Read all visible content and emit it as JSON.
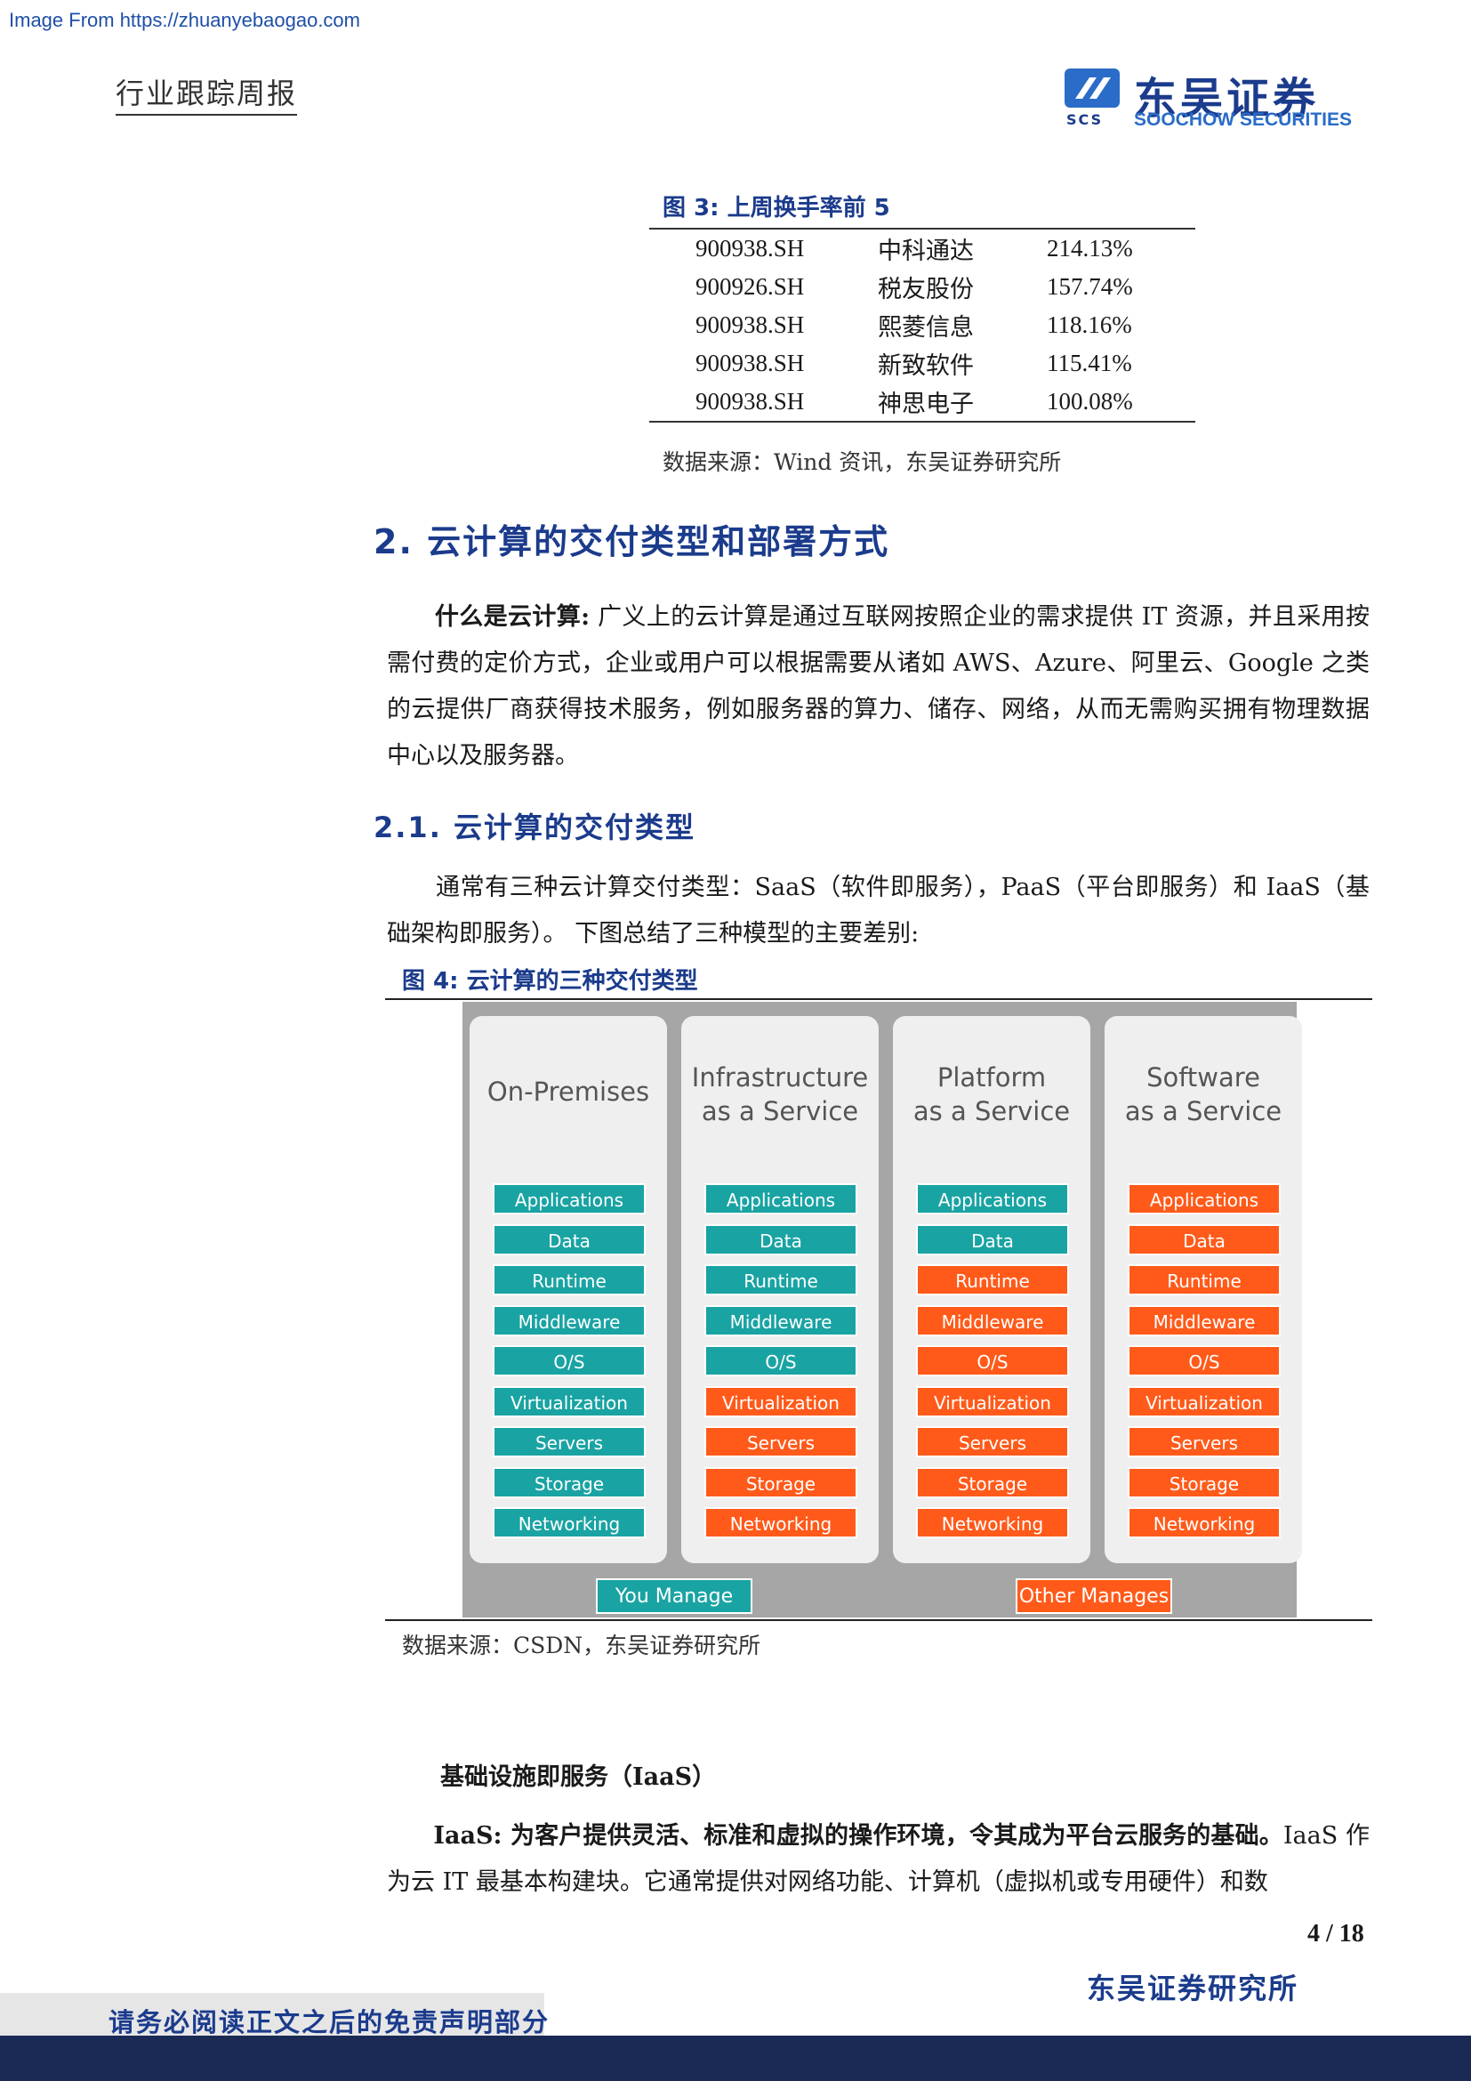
{
  "watermark": "Image From https://zhuanyebaogao.com",
  "header": {
    "title": "行业跟踪周报"
  },
  "logo": {
    "cn": "东吴证券",
    "en": "SOOCHOW SECURITIES",
    "mark": "SCS"
  },
  "figure3": {
    "title": "图 3:  上周换手率前 5",
    "rows": [
      [
        "900938.SH",
        "中科通达",
        "214.13%"
      ],
      [
        "900926.SH",
        "税友股份",
        "157.74%"
      ],
      [
        "900938.SH",
        "熙菱信息",
        "118.16%"
      ],
      [
        "900938.SH",
        "新致软件",
        "115.41%"
      ],
      [
        "900938.SH",
        "神思电子",
        "100.08%"
      ]
    ],
    "source": "数据来源：Wind 资讯，东吴证券研究所"
  },
  "section2": {
    "heading": "2.  云计算的交付类型和部署方式"
  },
  "para1": {
    "lead": "什么是云计算:",
    "text": " 广义上的云计算是通过互联网按照企业的需求提供 IT 资源，并且采用按需付费的定价方式，企业或用户可以根据需要从诸如 AWS、Azure、阿里云、Google 之类的云提供厂商获得技术服务，例如服务器的算力、储存、网络，从而无需购买拥有物理数据中心以及服务器。"
  },
  "section21": {
    "heading": "2.1.  云计算的交付类型"
  },
  "para2": {
    "text": "通常有三种云计算交付类型：SaaS（软件即服务），PaaS（平台即服务）和 IaaS（基础架构即服务）。 下图总结了三种模型的主要差别:"
  },
  "figure4": {
    "title": "图 4:  云计算的三种交付类型",
    "source": "数据来源：CSDN，东吴证券研究所",
    "colors": {
      "you_manage": "#1aa3a3",
      "other_manages": "#ff5a1a",
      "background": "#a6a6a6"
    },
    "columns": [
      {
        "title_lines": [
          "On-Premises"
        ],
        "managed_by_you": 9
      },
      {
        "title_lines": [
          "Infrastructure",
          "as a Service"
        ],
        "managed_by_you": 5
      },
      {
        "title_lines": [
          "Platform",
          "as a Service"
        ],
        "managed_by_you": 2
      },
      {
        "title_lines": [
          "Software",
          "as a Service"
        ],
        "managed_by_you": 0
      }
    ],
    "layers": [
      "Applications",
      "Data",
      "Runtime",
      "Middleware",
      "O/S",
      "Virtualization",
      "Servers",
      "Storage",
      "Networking"
    ],
    "legend": {
      "you": "You Manage",
      "other": "Other Manages"
    }
  },
  "iaas": {
    "heading": "基础设施即服务（IaaS）",
    "lead": "IaaS: 为客户提供灵活、标准和虚拟的操作环境，令其成为平台云服务的基础。",
    "text": "IaaS 作为云 IT 最基本构建块。它通常提供对网络功能、计算机（虚拟机或专用硬件）和数"
  },
  "footer": {
    "page": "4 / 18",
    "institute": "东吴证券研究所",
    "disclaimer": "请务必阅读正文之后的免责声明部分"
  }
}
